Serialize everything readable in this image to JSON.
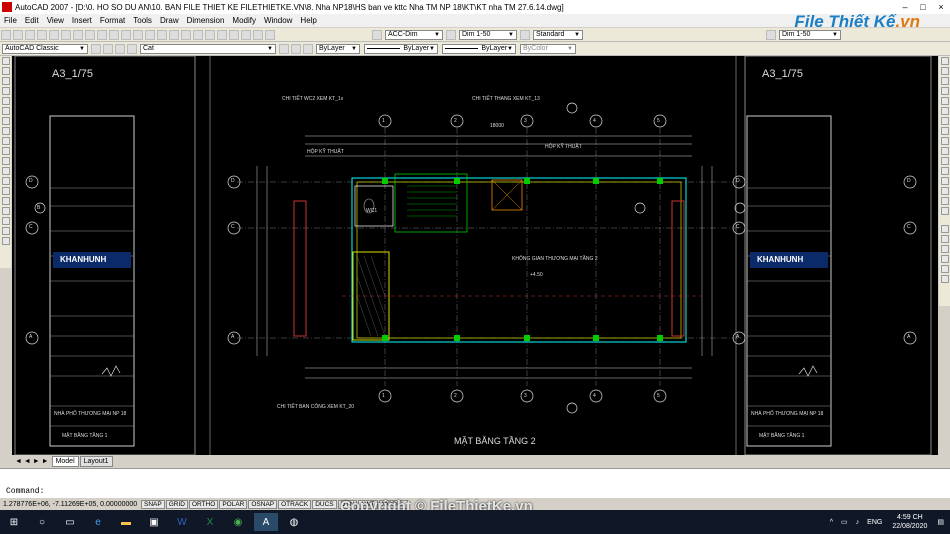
{
  "window": {
    "title": "AutoCAD 2007 - [D:\\0. HO SO DU AN\\10. BAN FILE THIET KE FILETHIETKE.VN\\8. Nha NP18\\HS ban ve kttc Nha TM NP 18\\KT\\KT nha TM 27.6.14.dwg]"
  },
  "brand": {
    "main": "File Thiết Kế",
    "suffix": ".vn"
  },
  "menu": [
    "File",
    "Edit",
    "View",
    "Insert",
    "Format",
    "Tools",
    "Draw",
    "Dimension",
    "Modify",
    "Window",
    "Help"
  ],
  "toolbar1": {
    "textstyle": "ACC-Dim",
    "dimstyle": "Dim 1-50",
    "tablestyle": "Standard",
    "mleaderstyle": "Dim 1-50"
  },
  "toolbar2": {
    "workspace": "AutoCAD Classic",
    "layer": "Cat",
    "color": "ByLayer",
    "linetype": "ByLayer",
    "lineweight": "ByLayer",
    "plotstyle": "ByColor"
  },
  "drawing": {
    "scale_left": "A3_1/75",
    "scale_right": "A3_1/75",
    "plan_title": "MẶT BẰNG TẦNG 2",
    "company": "KHANHUNH",
    "axes_top": [
      "1",
      "2",
      "3",
      "4",
      "5"
    ],
    "axes_side": [
      "D",
      "B",
      "C",
      "A"
    ],
    "labels": {
      "wc_detail": "CHI TIẾT WC2 XEM KT_1x",
      "stair_detail": "CHI TIẾT THANG XEM KT_13",
      "tech_box_left": "HỘP KỸ THUẬT",
      "tech_box_right": "HỘP KỸ THUẬT",
      "wc": "WC1",
      "commercial": "KHÔNG GIAN THƯƠNG MẠI TẦNG 2",
      "door_detail": "CHI TIẾT BAN CÔNG XEM KT_20",
      "dim_total": "18000",
      "level": "+4.50"
    },
    "title_block": {
      "project": "NHÀ PHỐ THƯƠNG MẠI NP 18",
      "sheet": "MẶT BẰNG TẦNG 1"
    }
  },
  "tabs": [
    "Model",
    "Layout1"
  ],
  "command": {
    "prompt": "Command:"
  },
  "status": {
    "coords": "1.278776E+06, -7.11269E+05, 0.00000000",
    "toggles": [
      "SNAP",
      "GRID",
      "ORTHO",
      "POLAR",
      "OSNAP",
      "OTRACK",
      "DUCS",
      "DYN",
      "LWT",
      "MODEL"
    ]
  },
  "watermark": "Copyright © FileThietKe.vn",
  "taskbar": {
    "time": "4:59 CH",
    "date": "22/08/2020",
    "lang": "ENG"
  },
  "colors": {
    "canvas": "#000000",
    "taskbar": "#101828",
    "brand": "#1a7fc4"
  }
}
